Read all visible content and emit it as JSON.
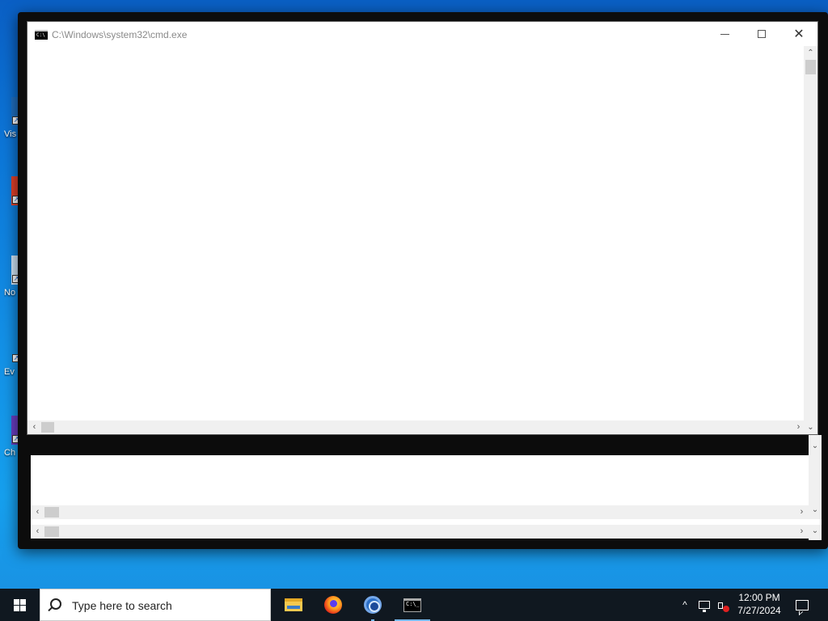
{
  "desktop": {
    "icons": [
      {
        "label": "Vis",
        "icon": "vscode-shortcut-icon"
      },
      {
        "label": "",
        "icon": "app-shortcut-icon"
      },
      {
        "label": "No",
        "icon": "notepad-shortcut-icon"
      },
      {
        "label": "Ev",
        "icon": "app-shortcut-icon"
      },
      {
        "label": "Ch",
        "icon": "chrome-shortcut-icon"
      }
    ]
  },
  "window": {
    "title": "C:\\Windows\\system32\\cmd.exe",
    "icon": "cmd-icon",
    "controls": {
      "minimize": "minimize-icon",
      "maximize": "maximize-icon",
      "close": "close-icon"
    },
    "close_glyph": "✕",
    "scroll_up_glyph": "⌃",
    "scroll_down_glyph": "⌄",
    "scroll_left_glyph": "‹",
    "scroll_right_glyph": "›"
  },
  "taskbar": {
    "search_placeholder": "Type here to search",
    "apps": [
      {
        "name": "File Explorer",
        "icon": "folder-icon"
      },
      {
        "name": "Firefox",
        "icon": "firefox-icon"
      },
      {
        "name": "Chrome",
        "icon": "chrome-icon"
      },
      {
        "name": "Command Prompt",
        "icon": "cmd-icon"
      }
    ],
    "tray": {
      "chevron": "^",
      "time": "12:00 PM",
      "date": "7/27/2024"
    }
  },
  "colors": {
    "taskbar_bg": "#101820",
    "desktop_blue": "#1390e6",
    "active_indicator": "#76b9ed"
  }
}
